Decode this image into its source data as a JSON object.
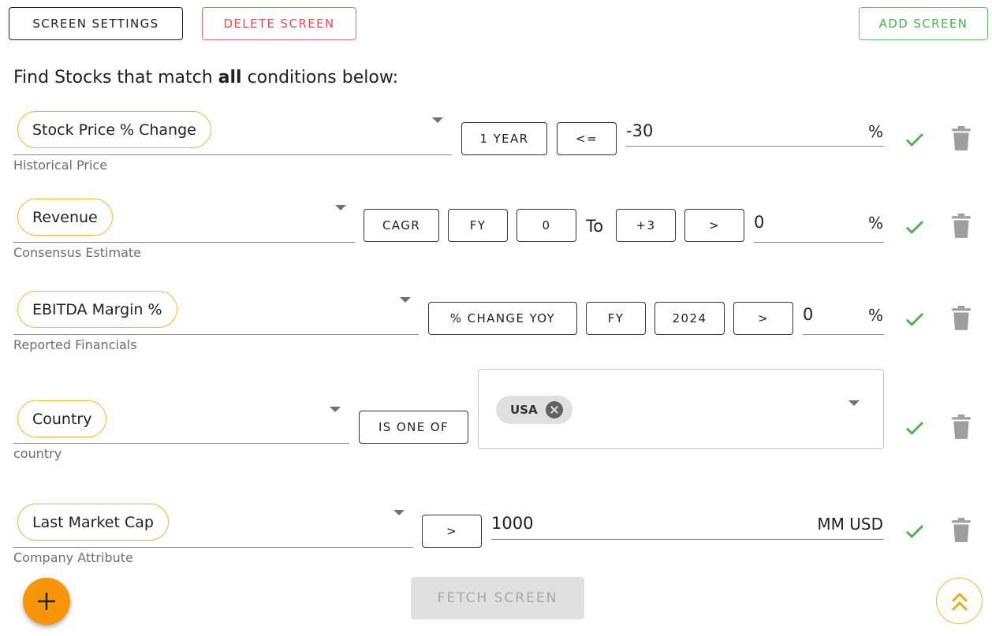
{
  "toolbar": {
    "screen_settings_label": "SCREEN SETTINGS",
    "delete_screen_label": "DELETE SCREEN",
    "add_screen_label": "ADD SCREEN"
  },
  "heading": {
    "prefix": "Find Stocks that match ",
    "bold": "all",
    "suffix": " conditions below:"
  },
  "conditions": [
    {
      "metric": "Stock Price % Change",
      "category": "Historical Price",
      "period": "1 YEAR",
      "operator": "<=",
      "value": "-30",
      "unit": "%"
    },
    {
      "metric": "Revenue",
      "category": "Consensus Estimate",
      "calc": "CAGR",
      "period_type": "FY",
      "from": "0",
      "to_label": "To",
      "to": "+3",
      "operator": ">",
      "value": "0",
      "unit": "%"
    },
    {
      "metric": "EBITDA Margin %",
      "category": "Reported Financials",
      "calc": "% CHANGE YOY",
      "period_type": "FY",
      "year": "2024",
      "operator": ">",
      "value": "0",
      "unit": "%"
    },
    {
      "metric": "Country",
      "category": "country",
      "operator": "IS ONE OF",
      "selected": [
        "USA"
      ]
    },
    {
      "metric": "Last Market Cap",
      "category": "Company Attribute",
      "operator": ">",
      "value": "1000",
      "unit": "MM USD"
    }
  ],
  "footer": {
    "fetch_label": "FETCH SCREEN"
  },
  "colors": {
    "accent_orange": "#f7960d",
    "pill_border": "#f0b73a",
    "check_green": "#4caf50",
    "delete_red": "#e05252",
    "add_green": "#4caf50"
  },
  "icons": [
    "check-icon",
    "trash-icon",
    "caret-down-icon",
    "plus-icon",
    "double-chevron-up-icon",
    "remove-chip-icon"
  ]
}
